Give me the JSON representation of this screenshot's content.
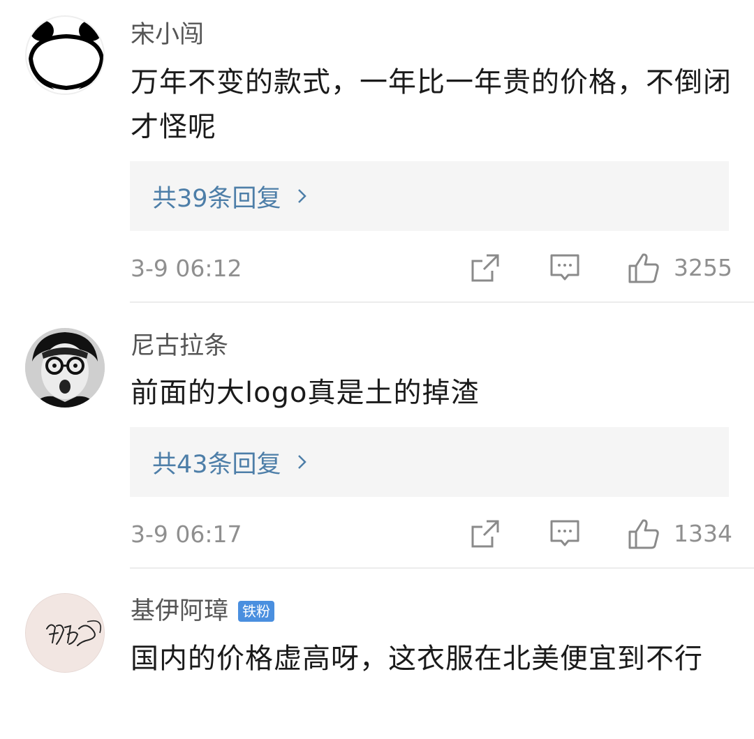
{
  "comments": [
    {
      "author": "宋小闯",
      "badge": "",
      "text": "万年不变的款式，一年比一年贵的价格，不倒闭才怪呢",
      "replies_label": "共39条回复",
      "time": "3-9 06:12",
      "likes": "3255",
      "avatar": "panda-avatar"
    },
    {
      "author": "尼古拉条",
      "badge": "",
      "text": "前面的大logo真是土的掉渣",
      "replies_label": "共43条回复",
      "time": "3-9 06:17",
      "likes": "1334",
      "avatar": "man-glasses-avatar"
    },
    {
      "author": "基伊阿璋",
      "badge": "铁粉",
      "text": "国内的价格虚高呀，这衣服在北美便宜到不行",
      "avatar": "signature-avatar"
    }
  ],
  "colors": {
    "reply_link": "#4d7ea8",
    "badge": "#4a8fdf",
    "meta_text": "#8f8f8f",
    "reply_bg": "#f5f5f5"
  },
  "icons": [
    "share-icon",
    "comment-icon",
    "like-icon",
    "chevron-right-icon"
  ]
}
